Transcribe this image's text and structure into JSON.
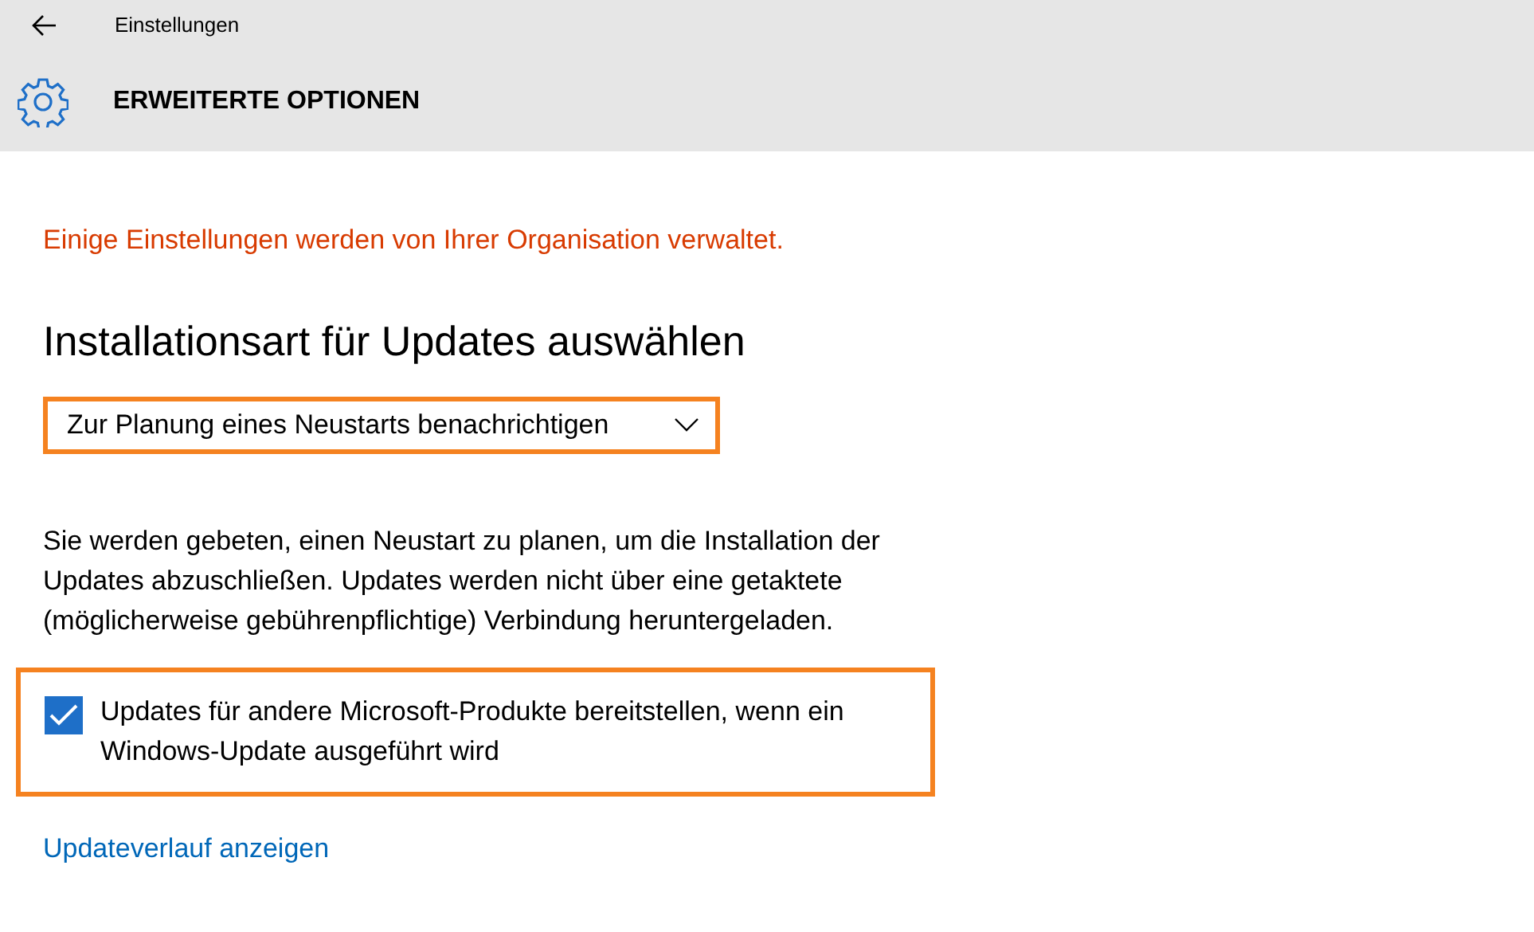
{
  "window": {
    "title": "Einstellungen"
  },
  "page": {
    "title": "ERWEITERTE OPTIONEN"
  },
  "notice": "Einige Einstellungen werden von Ihrer Organisation verwaltet.",
  "section": {
    "heading": "Installationsart für Updates auswählen"
  },
  "dropdown": {
    "value": "Zur Planung eines Neustarts benachrichtigen",
    "highlighted": true
  },
  "description": "Sie werden gebeten, einen Neustart zu planen, um die Installation der Updates abzuschließen. Updates werden nicht über eine getaktete (möglicherweise gebührenpflichtige) Verbindung heruntergeladen.",
  "checkbox": {
    "label": "Updates für andere Microsoft-Produkte bereitstellen, wenn ein Windows-Update ausgeführt wird",
    "checked": true,
    "highlighted": true
  },
  "link": "Updateverlauf anzeigen"
}
